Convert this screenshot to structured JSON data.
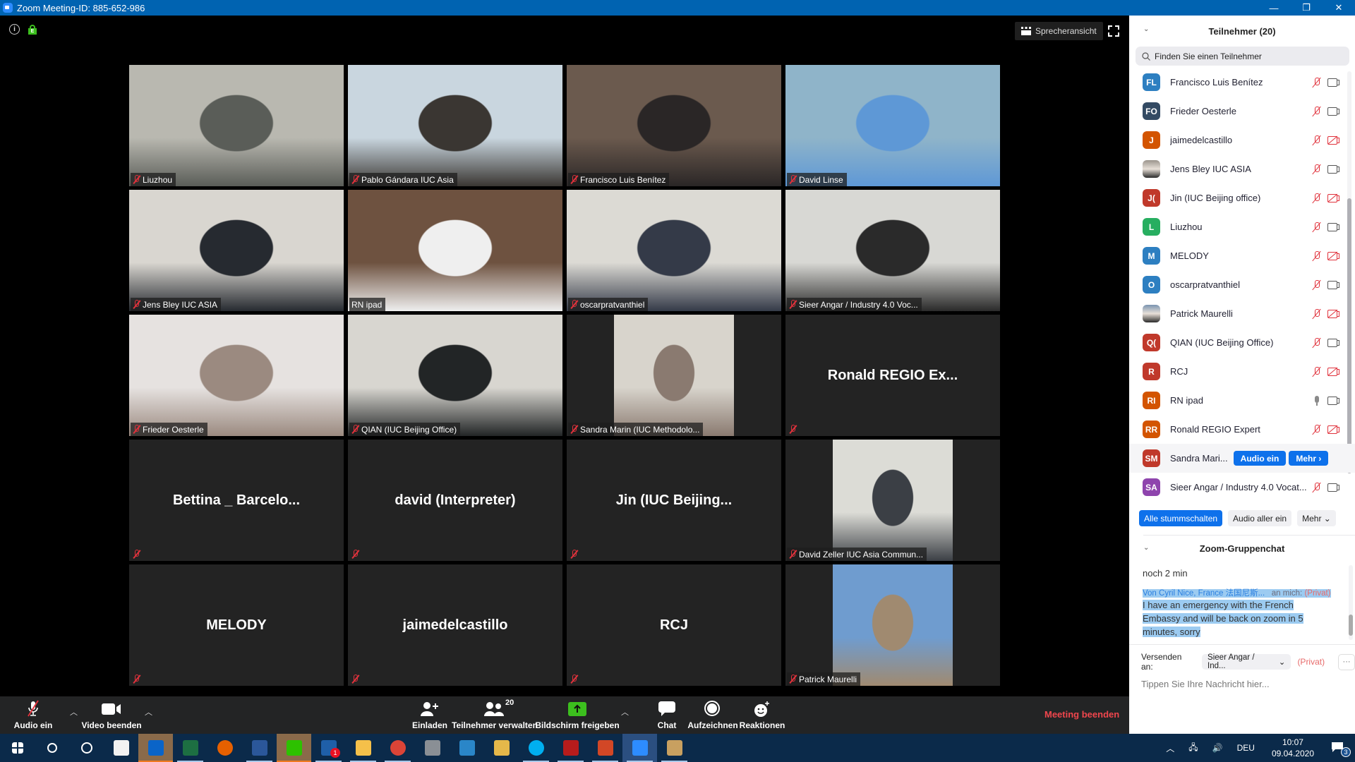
{
  "window": {
    "title": "Zoom Meeting-ID: 885-652-986",
    "controls": [
      "—",
      "❐",
      "✕"
    ]
  },
  "top_bar": {
    "info_icon": "info-icon",
    "lock_icon_letter": "E",
    "view_button_label": "Sprecheransicht"
  },
  "video_tiles": [
    {
      "name": "Liuzhou",
      "type": "video",
      "colors": [
        "#b9b8b0",
        "#5a5d58"
      ]
    },
    {
      "name": "Pablo Gándara IUC Asia",
      "type": "video",
      "colors": [
        "#c9d6df",
        "#3a3632"
      ]
    },
    {
      "name": "Francisco Luis Benítez",
      "type": "video",
      "colors": [
        "#6b5a4e",
        "#2a2626"
      ]
    },
    {
      "name": "David Linse",
      "type": "video",
      "colors": [
        "#8fb4c9",
        "#5e98d6"
      ]
    },
    {
      "name": "Jens Bley IUC ASIA",
      "type": "video",
      "colors": [
        "#d9d6d0",
        "#262a30"
      ]
    },
    {
      "name": "RN ipad",
      "type": "video",
      "active": true,
      "colors": [
        "#6e5240",
        "#efefef"
      ]
    },
    {
      "name": "oscarpratvanthiel",
      "type": "video",
      "colors": [
        "#dcdad4",
        "#343a48"
      ]
    },
    {
      "name": "Sieer Angar / Industry 4.0 Voc...",
      "type": "video",
      "colors": [
        "#d8d8d4",
        "#2a2a2a"
      ]
    },
    {
      "name": "Frieder Oesterle",
      "type": "video",
      "colors": [
        "#e6e2e0",
        "#9b8a80"
      ]
    },
    {
      "name": "QIAN (IUC Beijing Office)",
      "type": "video",
      "colors": [
        "#d8d6d0",
        "#222526"
      ]
    },
    {
      "name": "Sandra Marin (IUC Methodolo...",
      "type": "video-narrow",
      "colors": [
        "#d8d4cc",
        "#8a7a70"
      ]
    },
    {
      "name": "",
      "big_name": "Ronald  REGIO Ex...",
      "type": "name"
    },
    {
      "name": "",
      "big_name": "Bettina _ Barcelo...",
      "type": "name"
    },
    {
      "name": "",
      "big_name": "david (Interpreter)",
      "type": "name"
    },
    {
      "name": "",
      "big_name": "Jin (IUC Beijing...",
      "type": "name"
    },
    {
      "name": "David Zeller IUC Asia Commun...",
      "type": "video-narrow",
      "colors": [
        "#dcdcd6",
        "#3b3f45"
      ]
    },
    {
      "name": "",
      "big_name": "MELODY",
      "type": "name"
    },
    {
      "name": "",
      "big_name": "jaimedelcastillo",
      "type": "name"
    },
    {
      "name": "",
      "big_name": "RCJ",
      "type": "name"
    },
    {
      "name": "Patrick Maurelli",
      "type": "video-narrow",
      "colors": [
        "#6f9ccf",
        "#a08a70"
      ]
    }
  ],
  "toolbar": {
    "audio": "Audio ein",
    "video": "Video beenden",
    "invite": "Einladen",
    "participants": "Teilnehmer verwalten",
    "participants_count": "20",
    "share": "Bildschirm freigeben",
    "chat": "Chat",
    "record": "Aufzeichnen",
    "reactions": "Reaktionen",
    "end": "Meeting beenden"
  },
  "participants_panel": {
    "title": "Teilnehmer (20)",
    "search_placeholder": "Finden Sie einen Teilnehmer",
    "participants": [
      {
        "initials": "FL",
        "name": "Francisco Luis Benítez",
        "color": "#2d7fc1",
        "mic": "off",
        "cam": "on"
      },
      {
        "initials": "FO",
        "name": "Frieder Oesterle",
        "color": "#334a63",
        "mic": "off",
        "cam": "on"
      },
      {
        "initials": "J",
        "name": "jaimedelcastillo",
        "color": "#d35400",
        "mic": "off",
        "cam": "off"
      },
      {
        "initials": "",
        "name": "Jens Bley IUC ASIA",
        "color": "#9a948c",
        "photo": true,
        "mic": "off",
        "cam": "on"
      },
      {
        "initials": "J(",
        "name": "Jin (IUC Beijing office)",
        "color": "#c0392b",
        "mic": "off",
        "cam": "off"
      },
      {
        "initials": "L",
        "name": "Liuzhou",
        "color": "#27ae60",
        "mic": "off",
        "cam": "on"
      },
      {
        "initials": "M",
        "name": "MELODY",
        "color": "#2d7fc1",
        "mic": "off",
        "cam": "off"
      },
      {
        "initials": "O",
        "name": "oscarpratvanthiel",
        "color": "#2d7fc1",
        "mic": "off",
        "cam": "on"
      },
      {
        "initials": "",
        "name": "Patrick Maurelli",
        "color": "#7a94b0",
        "photo": true,
        "mic": "off",
        "cam": "off"
      },
      {
        "initials": "Q(",
        "name": "QIAN (IUC Beijing Office)",
        "color": "#c0392b",
        "mic": "off",
        "cam": "on"
      },
      {
        "initials": "R",
        "name": "RCJ",
        "color": "#c0392b",
        "mic": "off",
        "cam": "off"
      },
      {
        "initials": "RI",
        "name": "RN ipad",
        "color": "#d35400",
        "mic": "on",
        "cam": "on"
      },
      {
        "initials": "RR",
        "name": "Ronald REGIO Expert",
        "color": "#d35400",
        "mic": "off",
        "cam": "off"
      },
      {
        "initials": "SM",
        "name": "Sandra Mari...",
        "color": "#c0392b",
        "hover": true,
        "actions": [
          "Audio ein",
          "Mehr ›"
        ]
      },
      {
        "initials": "SA",
        "name": "Sieer Angar / Industry 4.0 Vocat...",
        "color": "#8e44ad",
        "mic": "off",
        "cam": "on"
      }
    ],
    "footer_buttons": [
      "Alle stummschalten",
      "Audio aller ein",
      "Mehr ⌄"
    ]
  },
  "chat_panel": {
    "title": "Zoom-Gruppenchat",
    "previous_message": "noch 2 min",
    "message": {
      "from": "Von Cyril Nice, France 法国尼斯...",
      "to": "an mich:",
      "privacy": "(Privat)",
      "text": "I have an emergency with the French Embassy and will be back on zoom in 5 minutes, sorry"
    },
    "send_to_label": "Versenden an:",
    "send_to_value": "Sieer Angar / Ind...",
    "send_to_privacy": "(Privat)",
    "more": "···",
    "input_placeholder": "Tippen Sie Ihre Nachricht hier..."
  },
  "taskbar": {
    "apps": [
      {
        "name": "start",
        "color": "#ffffff"
      },
      {
        "name": "search",
        "color": "#ffffff"
      },
      {
        "name": "cortana",
        "color": "#ffffff"
      },
      {
        "name": "store",
        "color": "#f2f2f2"
      },
      {
        "name": "outlook",
        "color": "#0a64c8",
        "highlight": true,
        "running": true
      },
      {
        "name": "excel",
        "color": "#1d6f42",
        "running": true
      },
      {
        "name": "firefox",
        "color": "#e66000"
      },
      {
        "name": "word",
        "color": "#2b579a",
        "running": true
      },
      {
        "name": "wechat",
        "color": "#2dc100",
        "highlight": true,
        "running": true
      },
      {
        "name": "whatsapp",
        "color": "#1f5fa8",
        "badge": "1",
        "running": true
      },
      {
        "name": "file-explorer",
        "color": "#f5c04a",
        "running": true
      },
      {
        "name": "chrome",
        "color": "#db4437",
        "running": true
      },
      {
        "name": "app-calculator",
        "color": "#8a8f95"
      },
      {
        "name": "network-app",
        "color": "#2a86c8"
      },
      {
        "name": "onedrive-folder",
        "color": "#e5b84a"
      },
      {
        "name": "skype",
        "color": "#00aff0",
        "running": true
      },
      {
        "name": "pdf",
        "color": "#b71c1c",
        "running": true
      },
      {
        "name": "powerpoint",
        "color": "#d24726",
        "running": true
      },
      {
        "name": "zoom",
        "color": "#2d8cff",
        "active": true,
        "running": true
      },
      {
        "name": "paint",
        "color": "#c8a060",
        "running": true
      }
    ],
    "tray": {
      "language": "DEU",
      "time": "10:07",
      "date": "09.04.2020",
      "notifications": "3"
    }
  }
}
